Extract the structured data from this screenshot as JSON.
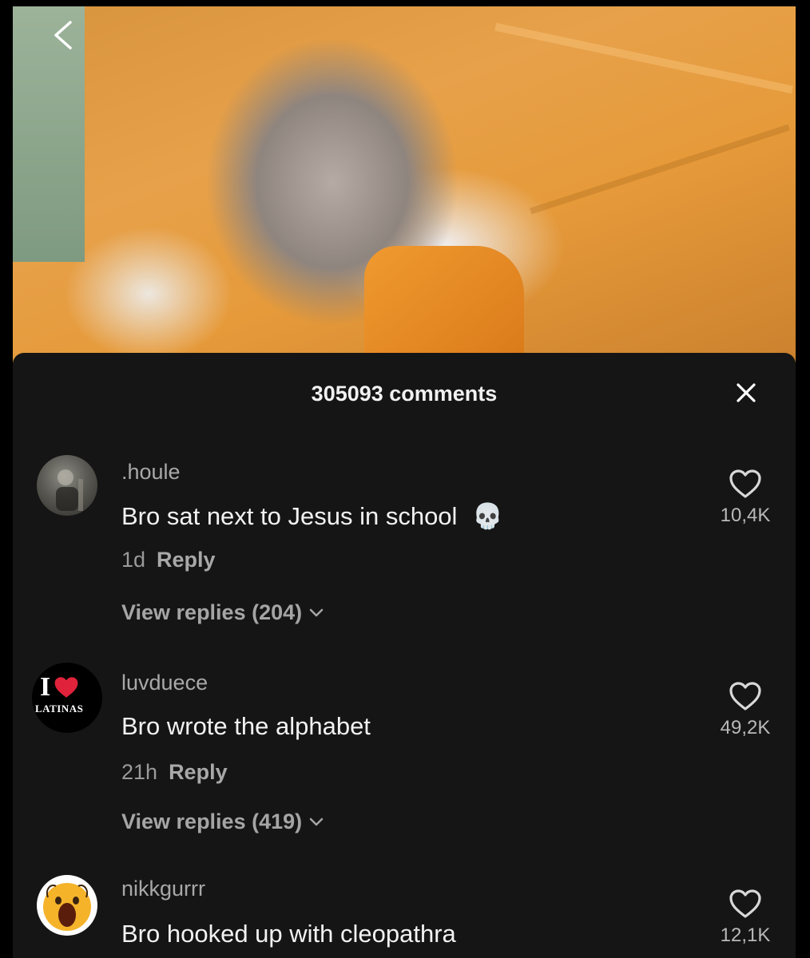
{
  "header": {
    "back_icon": "chevron-left-icon"
  },
  "sheet": {
    "title": "305093 comments",
    "close_icon": "close-icon"
  },
  "comments": [
    {
      "username": ".houle",
      "text": "Bro sat next to Jesus in school",
      "emoji": "💀",
      "time": "1d",
      "reply_label": "Reply",
      "view_replies": "View replies (204)",
      "likes": "10,4K",
      "avatar": "avatar-dark-photo"
    },
    {
      "username": "luvduece",
      "text": "Bro wrote the alphabet",
      "time": "21h",
      "reply_label": "Reply",
      "view_replies": "View replies (419)",
      "likes": "49,2K",
      "avatar": "avatar-i-love-latinas",
      "avatar_text": "I",
      "avatar_subtext": "LATINAS"
    },
    {
      "username": "nikkgurrr",
      "text": "Bro hooked up with cleopathra",
      "likes": "12,1K",
      "avatar": "avatar-screaming-emoji"
    }
  ],
  "colors": {
    "sheet_bg": "#151515",
    "heart_red": "#e0223a"
  }
}
